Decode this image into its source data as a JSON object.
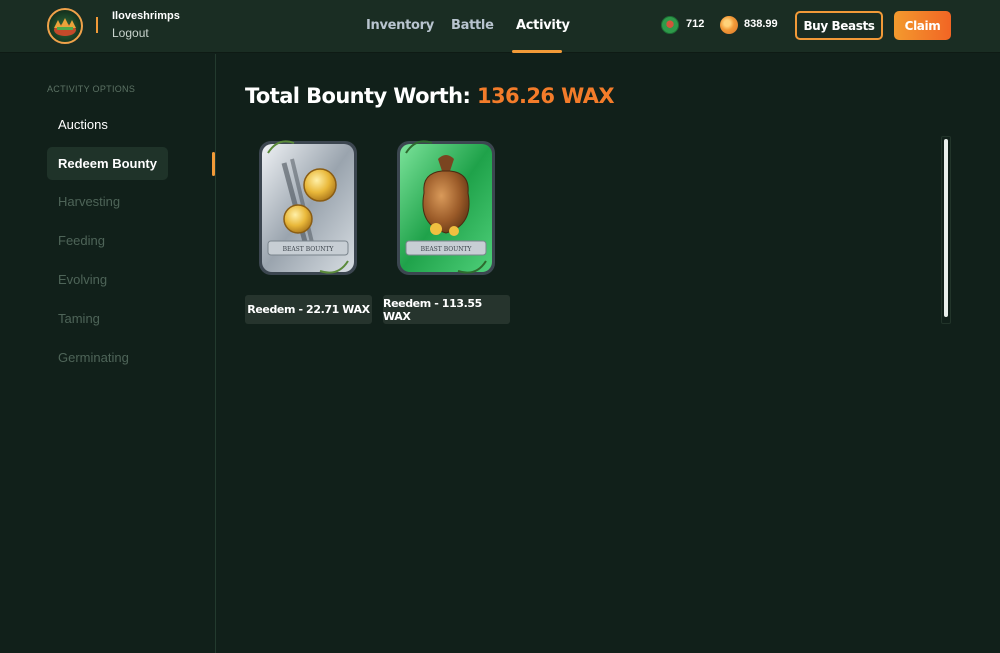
{
  "header": {
    "username": "Iloveshrimps",
    "logout_label": "Logout",
    "nav": [
      {
        "label": "Inventory"
      },
      {
        "label": "Battle"
      },
      {
        "label": "Activity",
        "active": true
      }
    ],
    "currencies": [
      {
        "icon": "green-token-icon",
        "value": "712",
        "color": "#2e9a4a"
      },
      {
        "icon": "orange-coin-icon",
        "value": "838.99",
        "color": "#f29a38"
      }
    ],
    "buy_beasts_label": "Buy Beasts",
    "claim_label": "Claim"
  },
  "sidebar": {
    "heading": "ACTIVITY OPTIONS",
    "items": [
      {
        "label": "Auctions",
        "state": "enabled"
      },
      {
        "label": "Redeem Bounty",
        "state": "selected"
      },
      {
        "label": "Harvesting",
        "state": "disabled"
      },
      {
        "label": "Feeding",
        "state": "disabled"
      },
      {
        "label": "Evolving",
        "state": "disabled"
      },
      {
        "label": "Taming",
        "state": "disabled"
      },
      {
        "label": "Germinating",
        "state": "disabled"
      }
    ]
  },
  "main": {
    "title_prefix": "Total Bounty Worth:",
    "title_value": "136.26 WAX",
    "cards": [
      {
        "ribbon": "BEAST BOUNTY",
        "variant": "silver",
        "icon": "gold-coins-icon",
        "redeem_label": "Reedem - 22.71 WAX"
      },
      {
        "ribbon": "BEAST BOUNTY",
        "variant": "green",
        "icon": "treasure-sack-icon",
        "redeem_label": "Reedem - 113.55 WAX"
      }
    ]
  },
  "colors": {
    "accent": "#f29a38",
    "background": "#11201a",
    "header": "#1a2d23",
    "title_value": "#f37c2a"
  }
}
